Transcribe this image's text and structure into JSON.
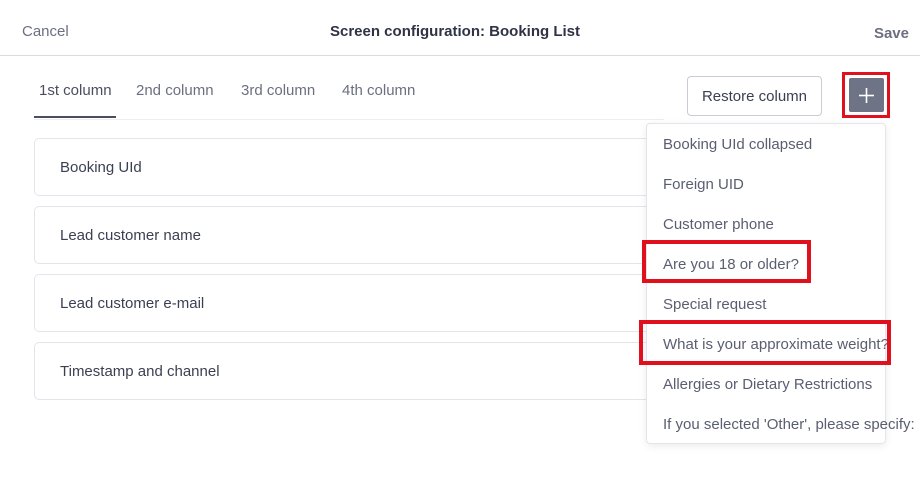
{
  "header": {
    "cancel_label": "Cancel",
    "title": "Screen configuration: Booking List",
    "save_label": "Save"
  },
  "tabs": [
    {
      "label": "1st column",
      "active": true
    },
    {
      "label": "2nd column"
    },
    {
      "label": "3rd column"
    },
    {
      "label": "4th column"
    }
  ],
  "toolbar": {
    "restore_label": "Restore column",
    "add_icon": "plus-icon"
  },
  "columns": [
    {
      "label": "Booking UId"
    },
    {
      "label": "Lead customer name"
    },
    {
      "label": "Lead customer e-mail"
    },
    {
      "label": "Timestamp and channel"
    }
  ],
  "dropdown": {
    "items": [
      {
        "label": "Booking UId collapsed"
      },
      {
        "label": "Foreign UID"
      },
      {
        "label": "Customer phone"
      },
      {
        "label": "Are you 18 or older?",
        "highlighted": true
      },
      {
        "label": "Special request"
      },
      {
        "label": "What is your approximate weight?",
        "highlighted": true
      },
      {
        "label": "Allergies or Dietary Restrictions"
      },
      {
        "label": "If you selected 'Other', please specify:"
      }
    ]
  },
  "colors": {
    "highlight": "#e0101c",
    "add_button": "#6e7385",
    "text": "#3b3f52"
  }
}
